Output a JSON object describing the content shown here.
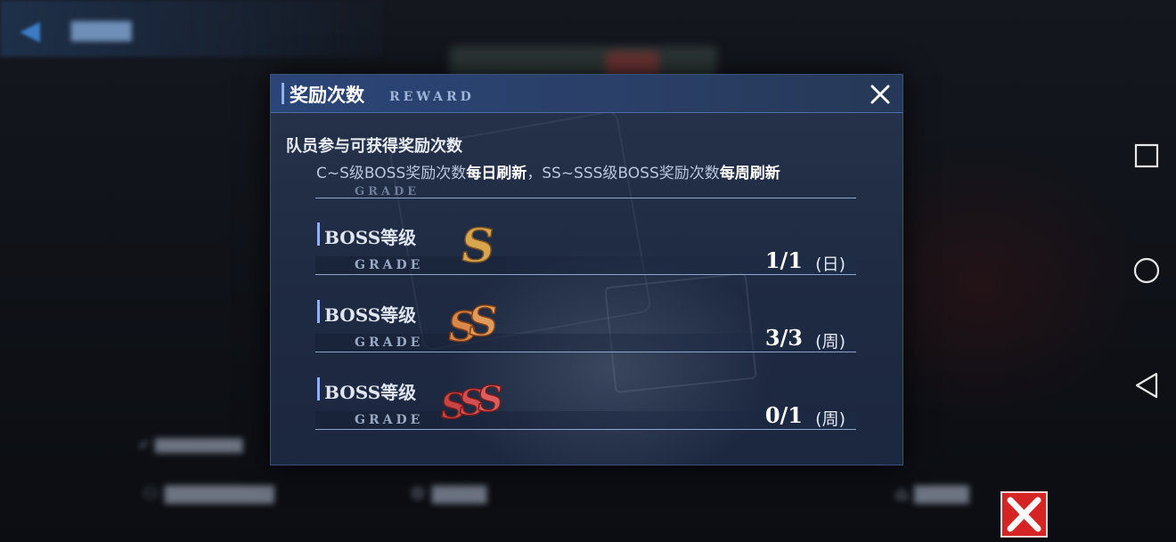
{
  "dialog": {
    "title": "奖励次数",
    "subtitle": "REWARD",
    "close_icon": "close-icon",
    "description_line1": "队员参与可获得奖励次数",
    "description_line2": {
      "part1": "C~S级BOSS奖励次数",
      "part2": "每日刷新",
      "part3": "，SS~SSS级BOSS奖励次数",
      "part4": "每周刷新"
    },
    "top_grade_partial": "GRADE",
    "rows": [
      {
        "label": "BOSS等级",
        "grade": "GRADE",
        "rank": "S",
        "rank_icon": "rank-s-icon",
        "count": "1/1",
        "period": "(日)",
        "color": "#d9a650"
      },
      {
        "label": "BOSS等级",
        "grade": "GRADE",
        "rank": "SS",
        "rank_icon": "rank-ss-icon",
        "count": "3/3",
        "period": "(周)",
        "color": "#d9884a"
      },
      {
        "label": "BOSS等级",
        "grade": "GRADE",
        "rank": "SSS",
        "rank_icon": "rank-sss-icon",
        "count": "0/1",
        "period": "(周)",
        "color": "#cf4a4a"
      }
    ]
  },
  "android_nav": {
    "recent_icon": "square-icon",
    "home_icon": "circle-icon",
    "back_icon": "triangle-back-icon"
  },
  "corner_button_icon": "red-x-close-icon",
  "colors": {
    "dialog_bg": "#1f2b42",
    "header_bg": "#2b4578",
    "accent_blue": "#8fb2ee",
    "close_red": "#d52424"
  }
}
